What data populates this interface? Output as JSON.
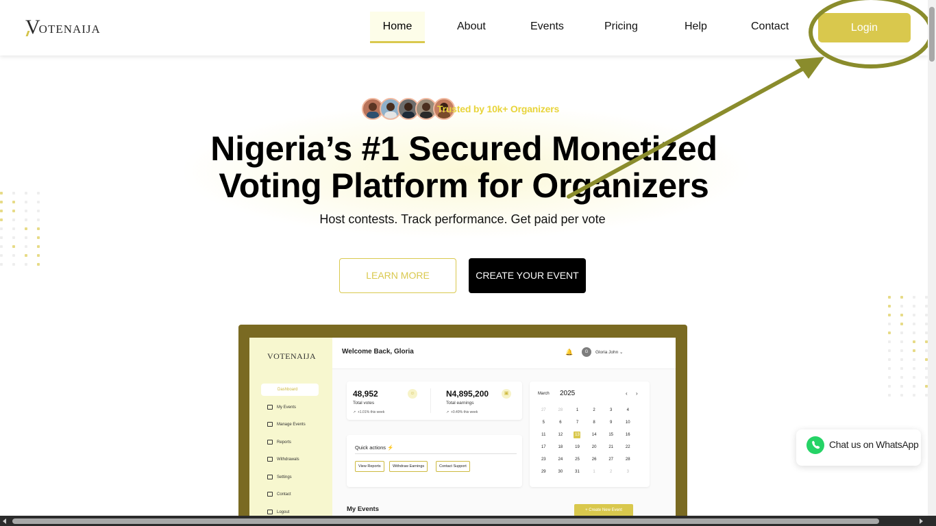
{
  "brand": {
    "logo_first": "V",
    "logo_rest": "OTENAIJA",
    "accent": "#d9c84d",
    "annotation_color": "#8a8c2c"
  },
  "nav": {
    "items": [
      "Home",
      "About",
      "Events",
      "Pricing",
      "Help",
      "Contact"
    ],
    "active": "Home",
    "login": "Login"
  },
  "hero": {
    "trusted": "Trusted by 10k+ Organizers",
    "headline_line1": "Nigeria’s #1 Secured Monetized",
    "headline_line2": "Voting Platform for Organizers",
    "subtitle": "Host contests. Track performance. Get paid per vote",
    "learn_more": "LEARN MORE",
    "create_event": "CREATE YOUR EVENT"
  },
  "dashboard_preview": {
    "logo": "VOTENAIJA",
    "welcome": "Welcome Back, Gloria",
    "user_initial": "G",
    "user_name": "Gloria John",
    "sidebar": [
      "Dashboard",
      "My Events",
      "Manage Events",
      "Reports",
      "Withdrawals",
      "Settings",
      "Contact",
      "Logout"
    ],
    "stats": [
      {
        "value": "48,952",
        "label": "Total votes",
        "trend": "+1.01% this week"
      },
      {
        "value": "N4,895,200",
        "label": "Total earnings",
        "trend": "+0.49% this week"
      }
    ],
    "quick_actions_title": "Quick actions",
    "quick_actions": [
      "View Reports",
      "Withdraw Earnings",
      "Contact Support"
    ],
    "calendar": {
      "month": "March",
      "year": "2025",
      "rows": [
        [
          "27",
          "28",
          "1",
          "2",
          "3",
          "4"
        ],
        [
          "5",
          "6",
          "7",
          "8",
          "9",
          "10"
        ],
        [
          "11",
          "12",
          "13",
          "14",
          "15",
          "16"
        ],
        [
          "17",
          "18",
          "19",
          "20",
          "21",
          "22"
        ],
        [
          "23",
          "24",
          "25",
          "26",
          "27",
          "28"
        ],
        [
          "29",
          "30",
          "31",
          "1",
          "2",
          "3"
        ]
      ],
      "selected": "13"
    },
    "my_events": "My Events",
    "new_event": "+ Create New Event"
  },
  "whatsapp": {
    "label": "Chat us on WhatsApp",
    "color": "#25d366"
  }
}
